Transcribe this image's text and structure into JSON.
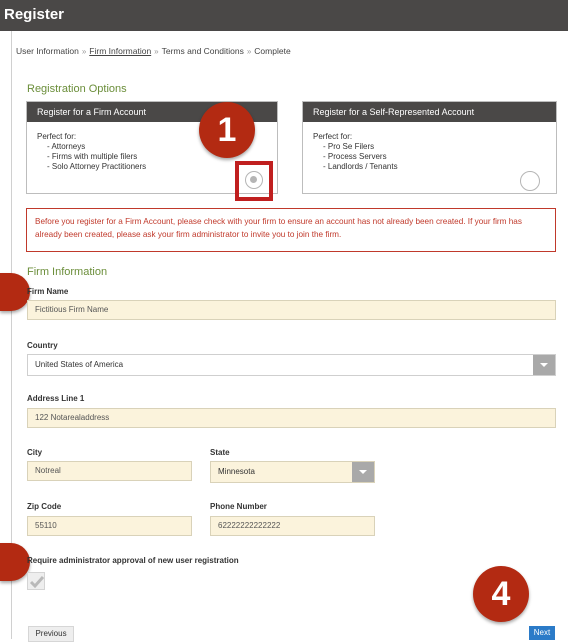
{
  "header": {
    "title": "Register"
  },
  "breadcrumb": {
    "step1": "User Information",
    "step2": "Firm Information",
    "step3": "Terms and Conditions",
    "step4": "Complete",
    "separator": "»"
  },
  "registration_options": {
    "title": "Registration Options",
    "firm": {
      "header": "Register for a Firm Account",
      "intro": "Perfect for:",
      "items": [
        "- Attorneys",
        "- Firms with multiple filers",
        "- Solo Attorney Practitioners"
      ],
      "selected": true
    },
    "self": {
      "header": "Register for a Self-Represented Account",
      "intro": "Perfect for:",
      "items": [
        "- Pro Se Filers",
        "- Process Servers",
        "- Landlords / Tenants"
      ],
      "selected": false
    }
  },
  "notice": "Before you register for a Firm Account, please check with your firm to ensure an account has not already been created. If your firm has already been created, please ask your firm administrator to invite you to join the firm.",
  "firm_info": {
    "title": "Firm Information",
    "firm_name": {
      "label": "Firm Name",
      "value": "Fictitious Firm Name"
    },
    "country": {
      "label": "Country",
      "value": "United States of America"
    },
    "address1": {
      "label": "Address Line 1",
      "value": "122 Notarealaddress"
    },
    "city": {
      "label": "City",
      "value": "Notreal"
    },
    "state": {
      "label": "State",
      "value": "Minnesota"
    },
    "zip": {
      "label": "Zip Code",
      "value": "55110"
    },
    "phone": {
      "label": "Phone Number",
      "value": "62222222222222"
    },
    "approval": {
      "label": "Require administrator approval of new user registration",
      "checked": true
    }
  },
  "buttons": {
    "previous": "Previous",
    "next": "Next"
  },
  "callouts": {
    "one": "1",
    "four": "4"
  },
  "colors": {
    "header_bg": "#4a4847",
    "section_green": "#6b8e3a",
    "callout_red": "#b32a12",
    "next_blue": "#2b7bc8",
    "field_bg": "#fbf3dc"
  }
}
